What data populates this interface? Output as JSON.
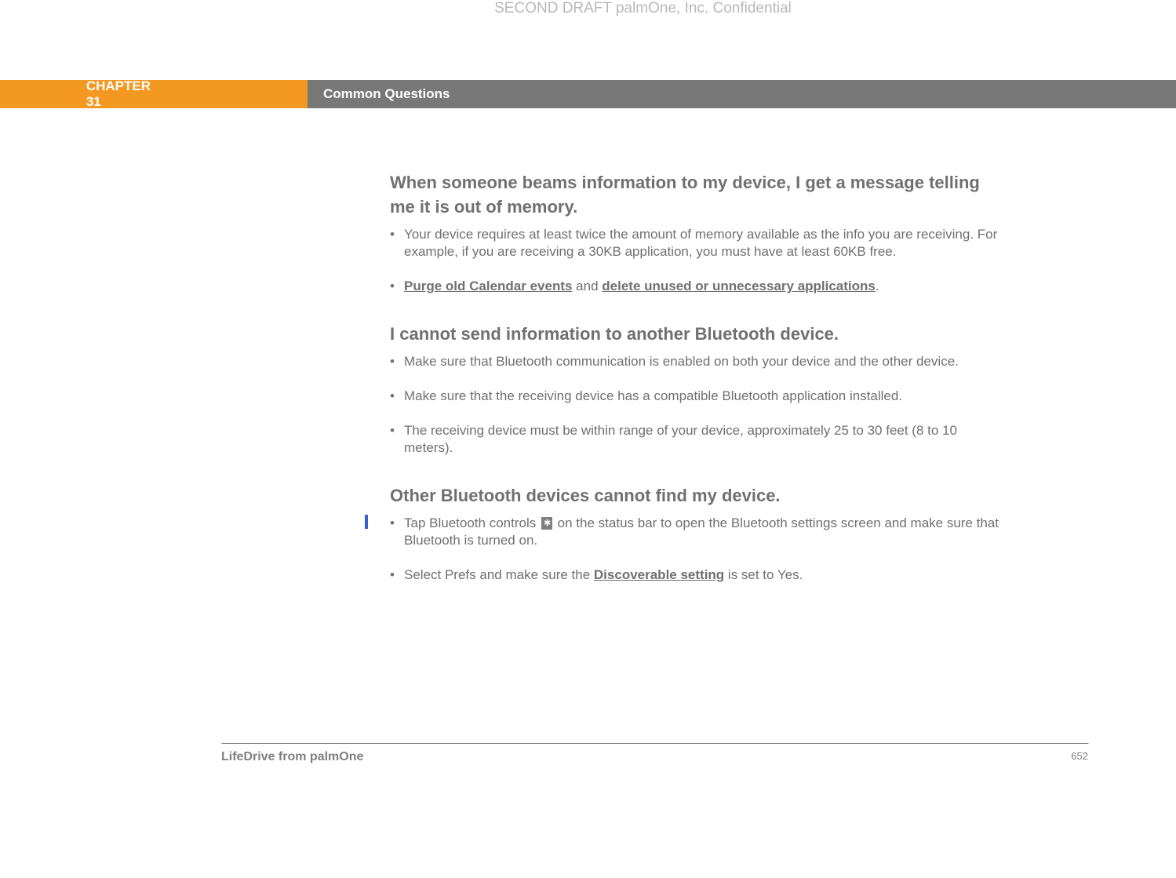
{
  "watermark": "SECOND DRAFT palmOne, Inc.  Confidential",
  "header": {
    "chapter": "CHAPTER 31",
    "section": "Common Questions"
  },
  "sections": [
    {
      "heading": "When someone beams information to my device, I get a message telling me it is out of memory.",
      "bullets": [
        {
          "text": "Your device requires at least twice the amount of memory available as the info you are receiving. For example, if you are receiving a 30KB application, you must have at least 60KB free."
        },
        {
          "link1": "Purge old Calendar events",
          "mid": " and ",
          "link2": "delete unused or unnecessary applications",
          "end": "."
        }
      ]
    },
    {
      "heading": "I cannot send information to another Bluetooth device.",
      "bullets": [
        {
          "text": "Make sure that Bluetooth communication is enabled on both your device and the other device."
        },
        {
          "text": "Make sure that the receiving device has a compatible Bluetooth application installed."
        },
        {
          "text": "The receiving device must be within range of your device, approximately 25 to 30 feet (8 to 10 meters)."
        }
      ]
    },
    {
      "heading": "Other Bluetooth devices cannot find my device.",
      "bullets": [
        {
          "pre": "Tap Bluetooth controls ",
          "post": " on the status bar to open the Bluetooth settings screen and make sure that Bluetooth is turned on.",
          "hasIcon": true,
          "hasChangeBar": true
        },
        {
          "pre": "Select Prefs and make sure the ",
          "link1": "Discoverable setting",
          "post": " is set to Yes."
        }
      ]
    }
  ],
  "footer": {
    "left": "LifeDrive from palmOne",
    "right": "652"
  }
}
